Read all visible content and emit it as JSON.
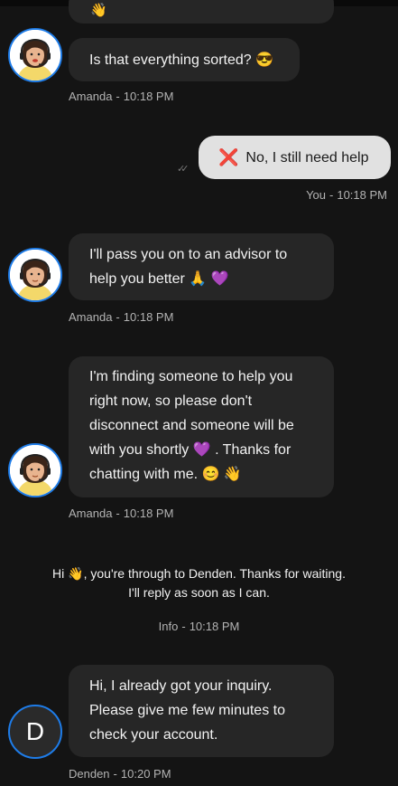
{
  "messages": [
    {
      "sender": "Amanda",
      "time": "10:18 PM",
      "lines": [
        "Is that everything sorted? 😎"
      ]
    },
    {
      "sender": "You",
      "time": "10:18 PM",
      "cross": "❌",
      "text": "No, I still need help"
    },
    {
      "sender": "Amanda",
      "time": "10:18 PM",
      "lines": [
        "I'll pass you on to an advisor to",
        "help you better 🙏 💜"
      ]
    },
    {
      "sender": "Amanda",
      "time": "10:18 PM",
      "lines": [
        "I'm finding someone to help you",
        "right now, so please don't",
        "disconnect and someone will be",
        "with you shortly 💜 . Thanks for",
        "chatting with me. 😊 👋"
      ]
    },
    {
      "sender": "Info",
      "time": "10:18 PM",
      "lines": [
        "Hi 👋, you're through to Denden. Thanks for waiting.",
        "I'll reply as soon as I can."
      ]
    },
    {
      "sender": "Denden",
      "time": "10:20 PM",
      "initial": "D",
      "lines": [
        "Hi, I already got your inquiry.",
        "Please give me few minutes to",
        "check your account."
      ]
    }
  ],
  "partial_emoji": "👋",
  "separator": "-",
  "icons": {
    "read_receipt": "double-check-icon",
    "avatar_agent": "agent-headset-avatar"
  },
  "colors": {
    "background": "#141414",
    "bubble": "#262626",
    "user_bubble": "#e1e1e1",
    "avatar_ring": "#1e7ce8",
    "meta": "#b3b3b3"
  }
}
